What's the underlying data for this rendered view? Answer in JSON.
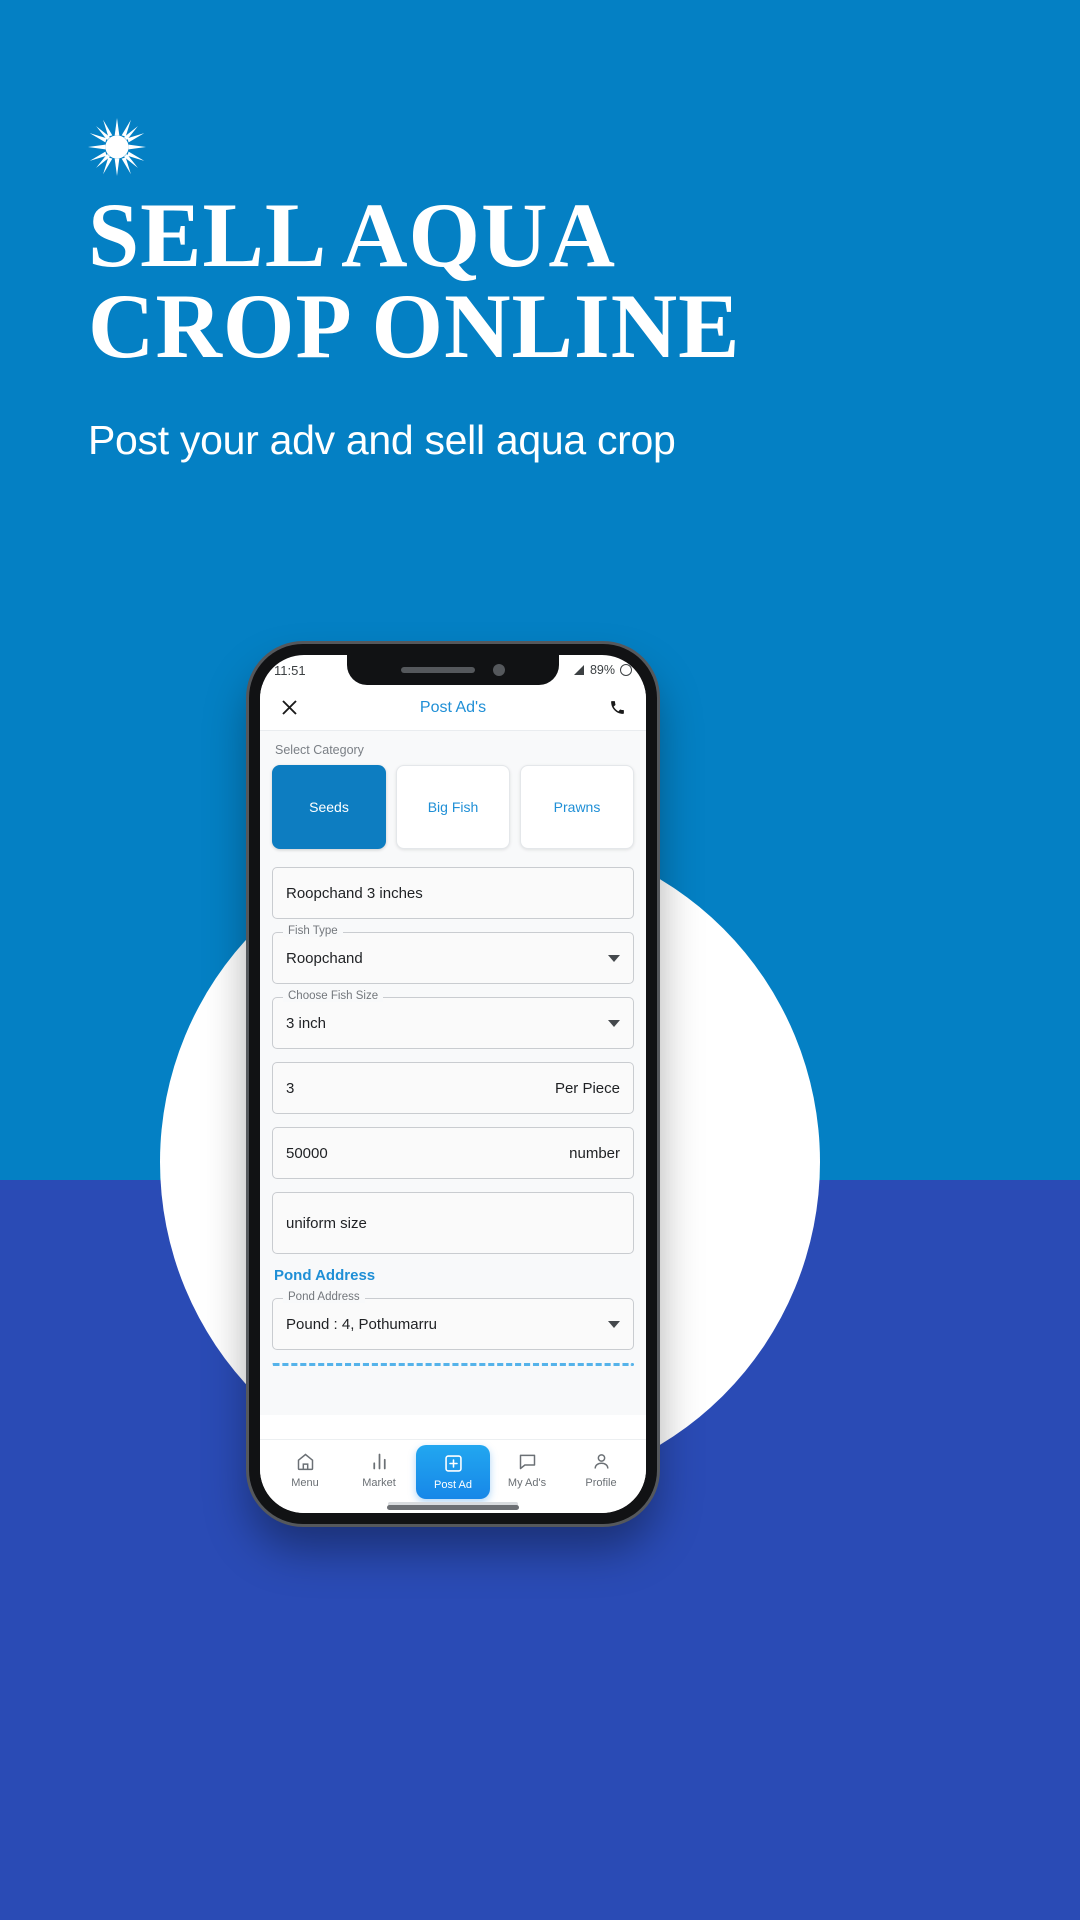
{
  "hero": {
    "badge_icon": "starburst-icon",
    "headline_line1": "SELL AQUA",
    "headline_line2": "CROP ONLINE",
    "subtitle": "Post your adv and sell aqua crop"
  },
  "colors": {
    "brand_blue": "#0480c4",
    "deep_blue": "#2a4bb5",
    "accent_blue": "#1f8fd6",
    "chip_active": "#0d7dc1",
    "nav_active": "#1787e8"
  },
  "phone": {
    "status": {
      "time": "11:51",
      "battery_percent": "89%",
      "signal_icon": "signal-triangle-icon",
      "battery_icon": "battery-ring-icon"
    },
    "appbar": {
      "close_icon": "close-icon",
      "title": "Post Ad's",
      "call_icon": "phone-call-icon"
    },
    "form": {
      "category_label": "Select Category",
      "categories": [
        {
          "label": "Seeds",
          "selected": true
        },
        {
          "label": "Big Fish",
          "selected": false
        },
        {
          "label": "Prawns",
          "selected": false
        }
      ],
      "fields": [
        {
          "name": "ad-title",
          "legend": "",
          "value": "Roopchand 3 inches",
          "suffix": "",
          "type": "text"
        },
        {
          "name": "fish-type",
          "legend": "Fish Type",
          "value": "Roopchand",
          "suffix": "",
          "type": "select"
        },
        {
          "name": "fish-size",
          "legend": "Choose Fish Size",
          "value": "3 inch",
          "suffix": "",
          "type": "select"
        },
        {
          "name": "price",
          "legend": "",
          "value": "3",
          "suffix": "Per Piece",
          "type": "text"
        },
        {
          "name": "quantity",
          "legend": "",
          "value": "50000",
          "suffix": "number",
          "type": "text"
        },
        {
          "name": "description",
          "legend": "",
          "value": "uniform size",
          "suffix": "",
          "type": "textarea"
        }
      ],
      "pond_section_title": "Pond Address",
      "pond_field": {
        "legend": "Pond Address",
        "value": "Pound : 4, Pothumarru"
      }
    },
    "bottomnav": [
      {
        "label": "Menu",
        "icon": "home-icon",
        "active": false
      },
      {
        "label": "Market",
        "icon": "bar-chart-icon",
        "active": false
      },
      {
        "label": "Post Ad",
        "icon": "plus-square-icon",
        "active": true
      },
      {
        "label": "My Ad's",
        "icon": "chat-bubble-icon",
        "active": false
      },
      {
        "label": "Profile",
        "icon": "person-icon",
        "active": false
      }
    ]
  }
}
